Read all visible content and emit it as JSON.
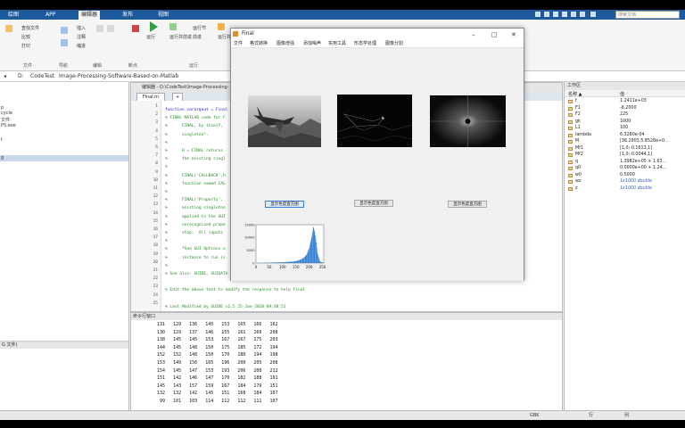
{
  "top_tabs": [
    "绘图",
    "APP",
    "编辑器",
    "发布",
    "视图"
  ],
  "search_placeholder": "搜索文档",
  "ribbon": {
    "buttons": [
      "查找文件",
      "比较",
      "打印",
      "插入",
      "注释",
      "缩进",
      "运行",
      "运行并前进",
      "前进",
      "运行节",
      "运行并计时"
    ],
    "groups": [
      "文件",
      "导航",
      "编辑",
      "断点",
      "运行"
    ]
  },
  "address": {
    "segments": [
      "D:",
      "CodeTest",
      "Image-Processing-Software-Based-on-Matlab"
    ]
  },
  "left_panel": {
    "items": [
      "...",
      "p",
      "cycle",
      "文件",
      "PS.exe",
      "t",
      "g"
    ],
    "footer": "G 文件)"
  },
  "editor": {
    "title": "编辑器 - D:\\CodeTest\\Image-Processing-",
    "tabs": [
      "Final.m",
      "+"
    ],
    "lines": [
      {
        "n": "1",
        "text": "function varargout = Final",
        "kw": true
      },
      {
        "n": "2",
        "text": "% FINAL MATLAB code for F",
        "kw": false
      },
      {
        "n": "3",
        "text": "%      FINAL, by itself,",
        "kw": false
      },
      {
        "n": "4",
        "text": "%      singleton*.",
        "kw": false
      },
      {
        "n": "5",
        "text": "%",
        "kw": false
      },
      {
        "n": "6",
        "text": "%      H = FINAL returns",
        "kw": false
      },
      {
        "n": "7",
        "text": "%      the existing singl",
        "kw": false
      },
      {
        "n": "8",
        "text": "%",
        "kw": false
      },
      {
        "n": "9",
        "text": "%      FINAL('CALLBACK',h",
        "kw": false
      },
      {
        "n": "10",
        "text": "%      function named CAL",
        "kw": false
      },
      {
        "n": "11",
        "text": "%",
        "kw": false
      },
      {
        "n": "12",
        "text": "%      FINAL('Property',",
        "kw": false
      },
      {
        "n": "13",
        "text": "%      existing singleton",
        "kw": false
      },
      {
        "n": "14",
        "text": "%      applied to the GUI",
        "kw": false
      },
      {
        "n": "15",
        "text": "%      unrecognized prope",
        "kw": false
      },
      {
        "n": "16",
        "text": "%      stop.  All inputs",
        "kw": false
      },
      {
        "n": "17",
        "text": "%",
        "kw": false
      },
      {
        "n": "18",
        "text": "%      *See GUI Options o",
        "kw": false
      },
      {
        "n": "19",
        "text": "%      instance to run (s",
        "kw": false
      },
      {
        "n": "20",
        "text": "%",
        "kw": false
      },
      {
        "n": "21",
        "text": "% See also: GUIDE, GUIDATA",
        "kw": false
      },
      {
        "n": "22",
        "text": "",
        "kw": false
      },
      {
        "n": "23",
        "text": "% Edit the above text to modify the response to help Final",
        "kw": false
      },
      {
        "n": "24",
        "text": "",
        "kw": false
      },
      {
        "n": "25",
        "text": "% Last Modified by GUIDE v2.5 25-Jan-2018 09:40:51",
        "kw": false
      }
    ]
  },
  "command_window": {
    "title": "命令行窗口",
    "rows": [
      "   131   129   136   145   153   165   166   162",
      "   130   129   137   146   155   161   160   208",
      "   138   145   145   153   167   167   175   203",
      "   144   145   148   150   175   185   172   194",
      "   152   152   148   150   170   180   194   198",
      "   153   149   156   165   196   200   205   208",
      "   154   145   147   153   193   206   208   212",
      "   151   142   146   147   170   182   188   191",
      "   145   143   157   159   167   184   179   151",
      "   132   132   142   145   151   168   184   167",
      "    99   101   103   114   112   112   111   107"
    ],
    "prompt": "fx"
  },
  "workspace": {
    "title": "工作区",
    "col_name": "名称 ▲",
    "col_value": "值",
    "vars": [
      {
        "name": "f",
        "value": "1.2411e+03",
        "italic": false
      },
      {
        "name": "F1",
        "value": "-6.2000",
        "italic": false
      },
      {
        "name": "F2",
        "value": "225",
        "italic": false
      },
      {
        "name": "gk",
        "value": "1000",
        "italic": false
      },
      {
        "name": "L1",
        "value": "100",
        "italic": false
      },
      {
        "name": "lambda",
        "value": "6.3280e-04",
        "italic": false
      },
      {
        "name": "M",
        "value": "[36.2903,5.8528e+0...",
        "italic": false
      },
      {
        "name": "Mf1",
        "value": "[1,0;-0.1613,1]",
        "italic": false
      },
      {
        "name": "Mf2",
        "value": "[1,0;-0.0044,1]",
        "italic": false
      },
      {
        "name": "q",
        "value": "1.3982e+05 + 1.63...",
        "italic": false
      },
      {
        "name": "q0",
        "value": "0.0000e+00 + 1.24...",
        "italic": false
      },
      {
        "name": "w0",
        "value": "0.5000",
        "italic": false
      },
      {
        "name": "wz",
        "value": "1x1000 double",
        "italic": true
      },
      {
        "name": "z",
        "value": "1x1000 double",
        "italic": true
      }
    ]
  },
  "status": {
    "encoding": "GBK",
    "ln": "行",
    "col": "列"
  },
  "figure": {
    "title": "Final",
    "menus": [
      "文件",
      "格式转换",
      "图像增强",
      "添加噪声",
      "实用工具",
      "形态学处理",
      "图像分割"
    ],
    "button1": "显示色度直方图",
    "button2": "显示色度直方图",
    "button3": "显示色度直方图",
    "hist_ticks_x": [
      "0",
      "50",
      "100",
      "150",
      "200",
      "250"
    ],
    "hist_ticks_y": [
      "15000",
      "10000",
      "5000",
      "0"
    ]
  },
  "chart_data": {
    "type": "bar",
    "title": "",
    "xlabel": "",
    "ylabel": "",
    "xlim": [
      0,
      255
    ],
    "ylim": [
      0,
      15000
    ],
    "x": [
      0,
      20,
      40,
      60,
      80,
      100,
      120,
      140,
      150,
      160,
      170,
      180,
      190,
      200,
      205,
      210,
      215,
      220,
      225,
      230,
      240,
      255
    ],
    "values": [
      0,
      60,
      120,
      180,
      250,
      320,
      450,
      620,
      800,
      1100,
      1500,
      2200,
      3400,
      6000,
      8500,
      11000,
      14500,
      12000,
      9000,
      4000,
      600,
      50
    ]
  },
  "colors": {
    "tabbar": "#1c5a9c",
    "accent_blue": "#3a7bd5",
    "hist_bar": "#2b7bd4"
  }
}
